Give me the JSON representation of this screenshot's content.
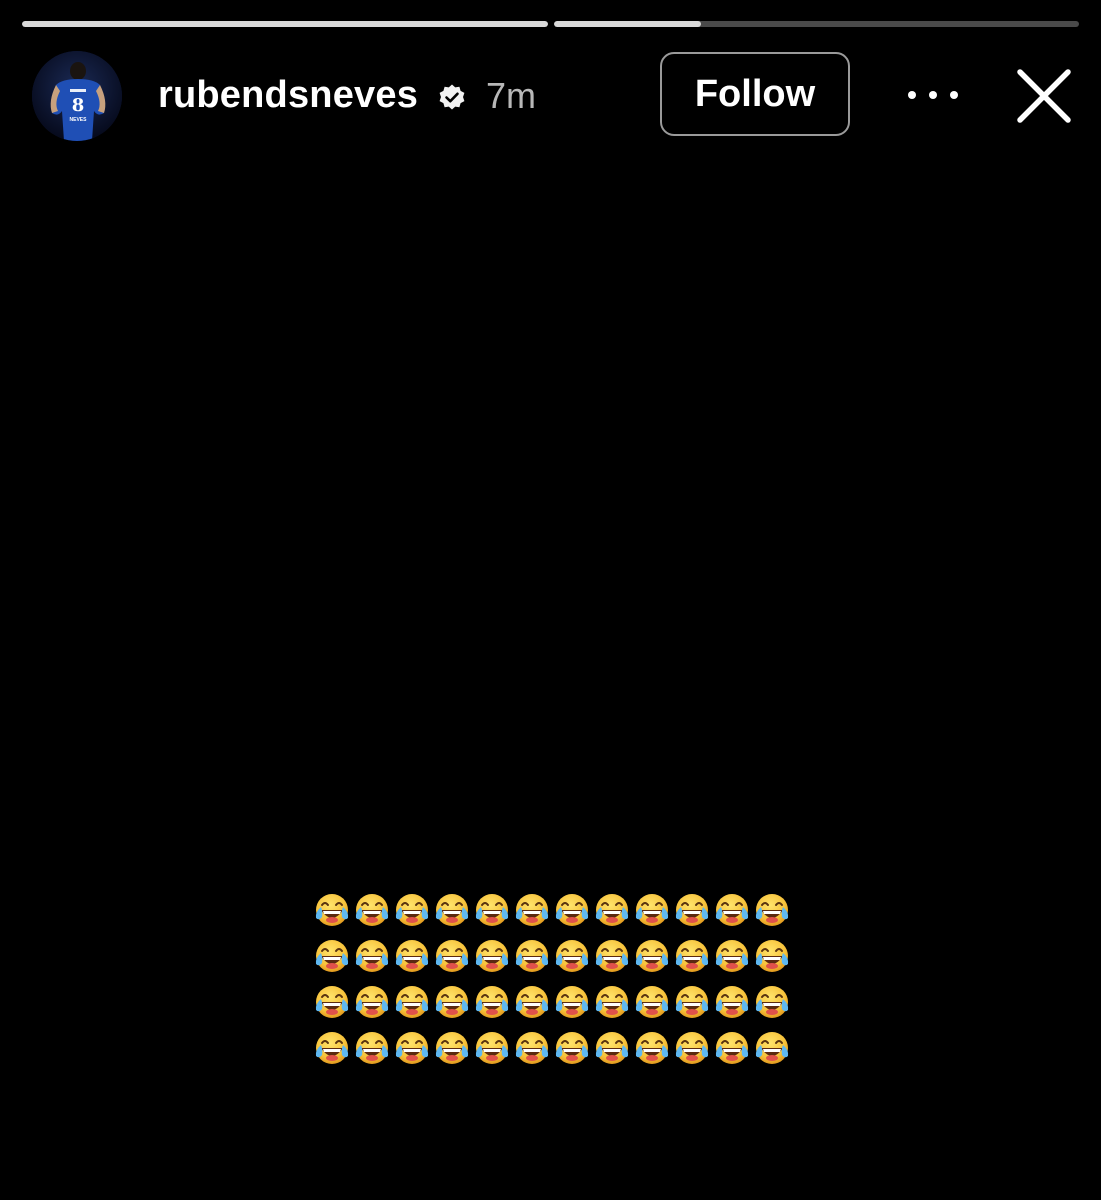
{
  "progress": {
    "segments": [
      {
        "fill": 1.0
      },
      {
        "fill": 0.28
      }
    ]
  },
  "header": {
    "username": "rubendsneves",
    "timestamp": "7m",
    "follow_label": "Follow"
  },
  "story": {
    "emoji_rows": 4,
    "emoji_per_row": 12,
    "emoji_name": "face-with-tears-of-joy"
  },
  "colors": {
    "background": "#000000",
    "progress_track": "#4a4a4a",
    "progress_fill": "#d9d9d9",
    "timestamp": "#b8b8b8"
  }
}
